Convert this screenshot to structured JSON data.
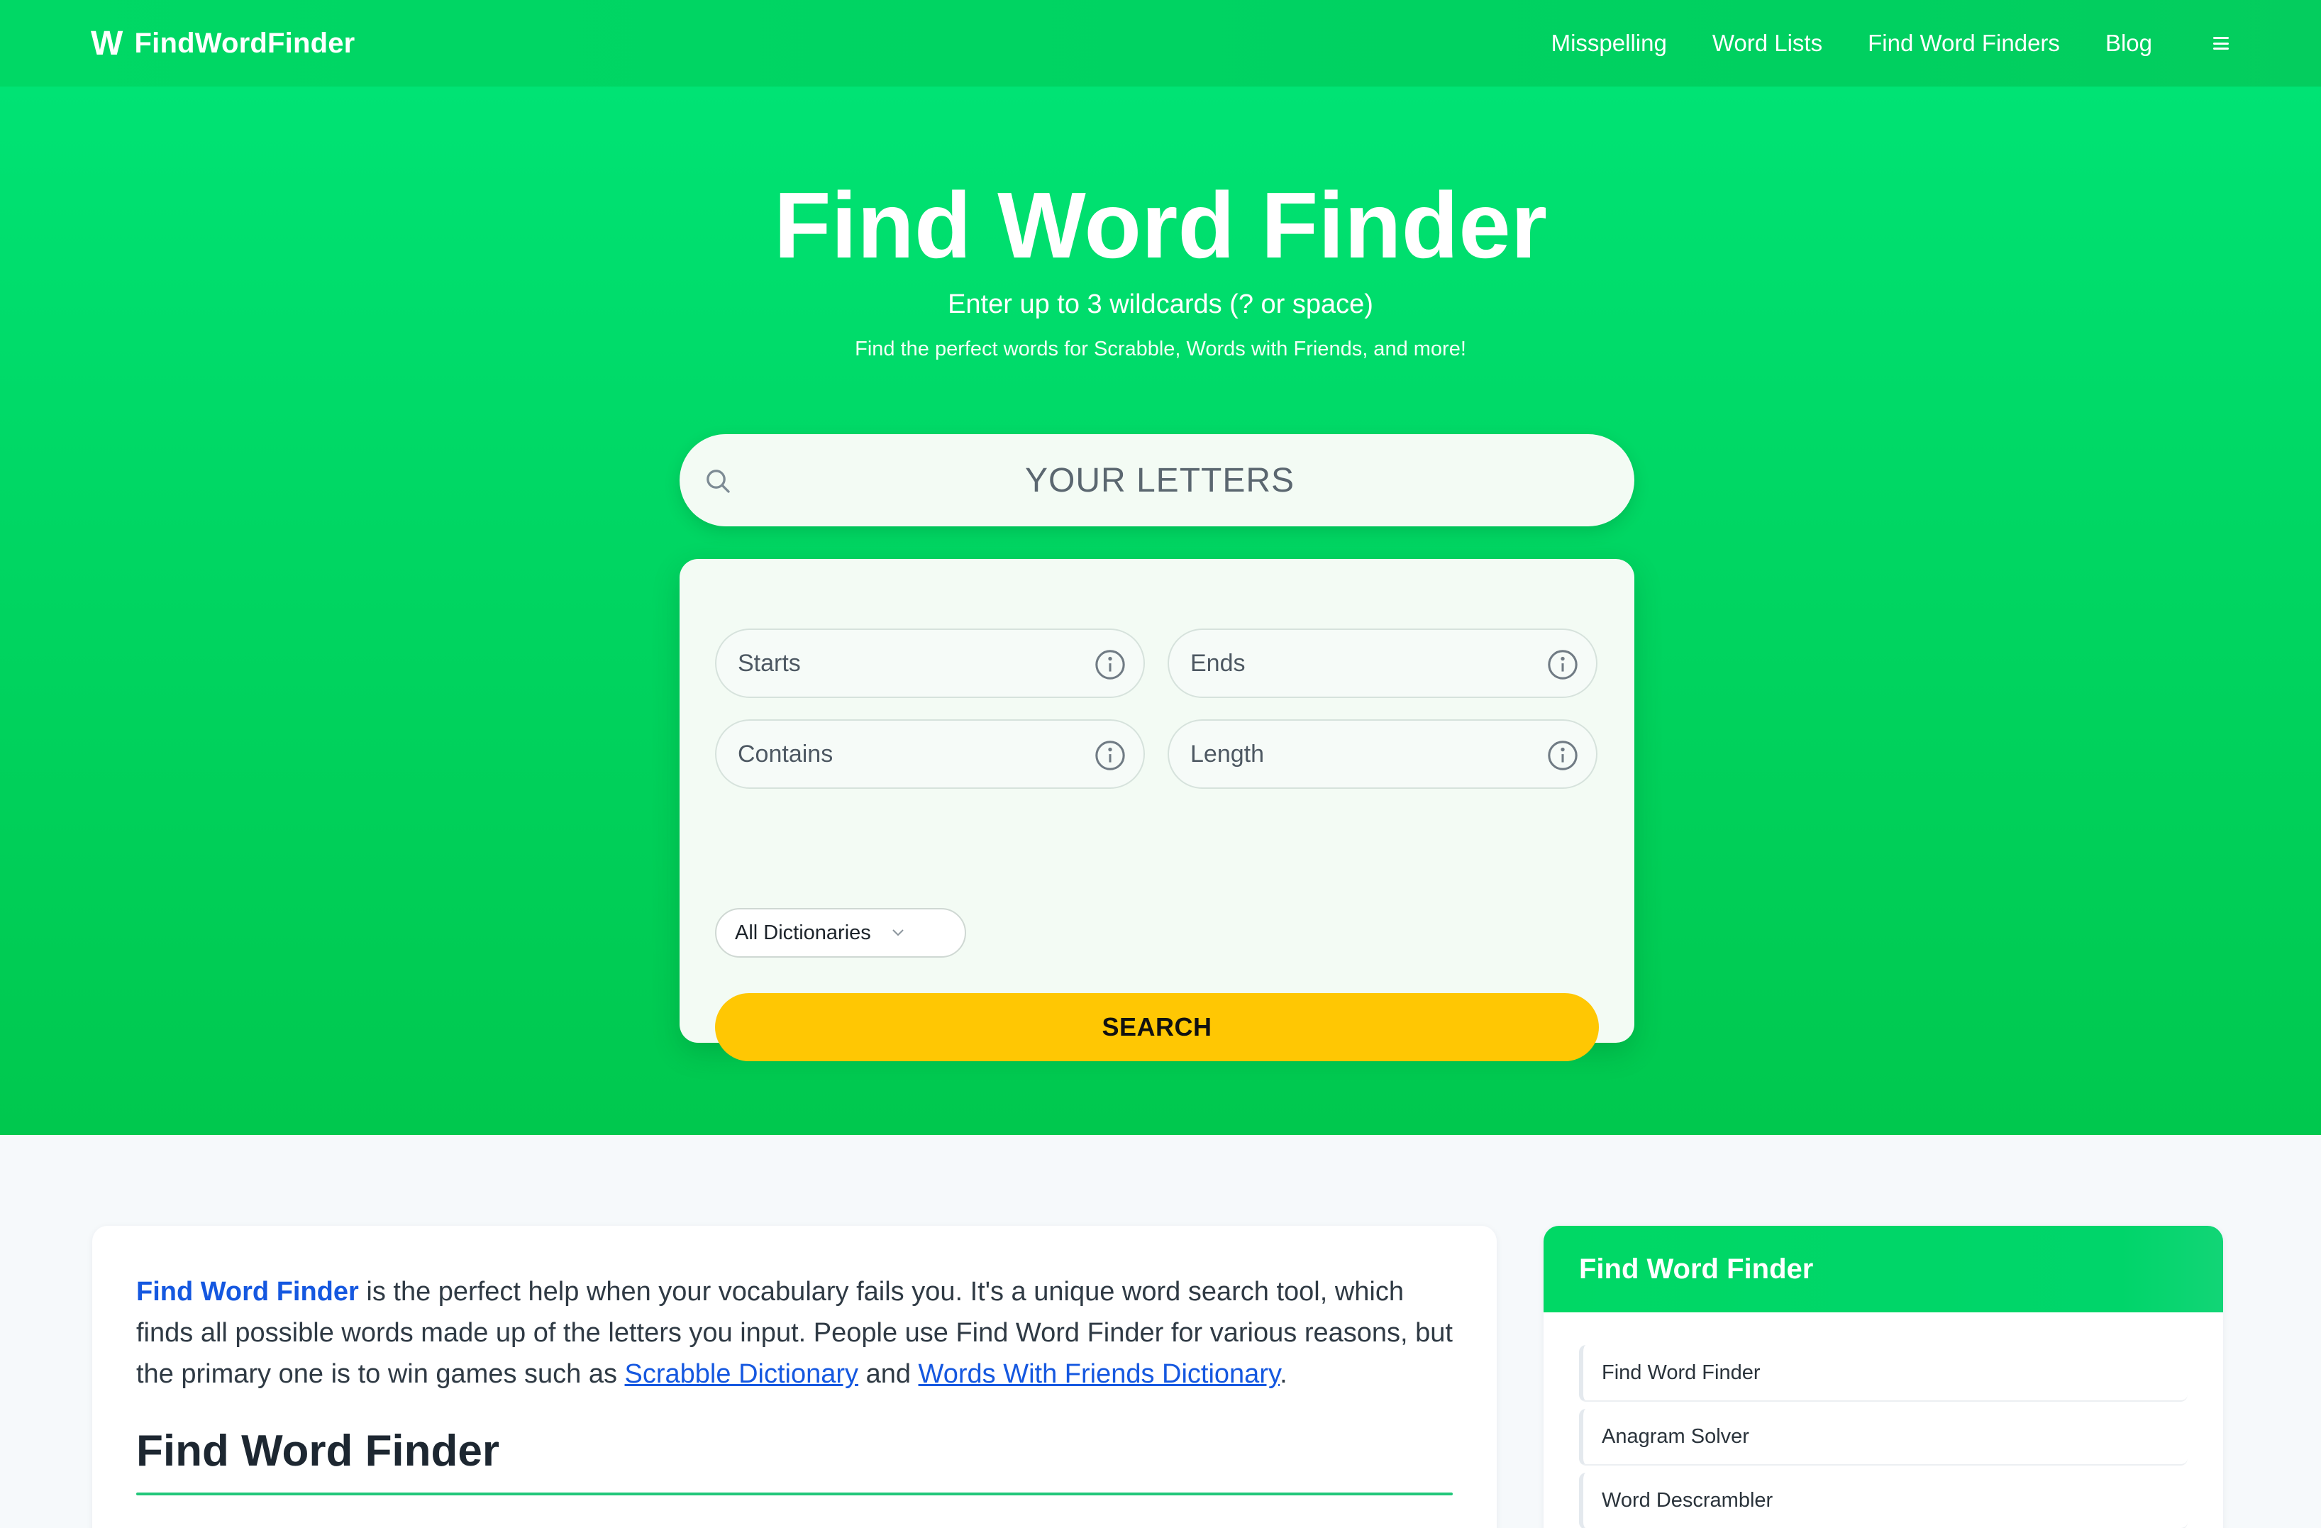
{
  "nav": {
    "brand_mark": "W",
    "brand": "FindWordFinder",
    "links": [
      "Misspelling",
      "Word Lists",
      "Find Word Finders",
      "Blog"
    ],
    "menu_icon": "hamburger-menu-icon"
  },
  "hero": {
    "title": "Find Word Finder",
    "subtitle": "Enter up to 3 wildcards (? or space)",
    "tagline": "Find the perfect words for Scrabble, Words with Friends, and more!",
    "search": {
      "placeholder": "YOUR LETTERS",
      "icon": "search-icon"
    },
    "filters": {
      "starts": "Starts",
      "ends": "Ends",
      "contains": "Contains",
      "length": "Length",
      "info_icon": "info-icon"
    },
    "dictionary": {
      "selected": "All Dictionaries"
    },
    "search_button": "SEARCH"
  },
  "article": {
    "intro_link": "Find Word Finder",
    "intro_text": " is the perfect help when your vocabulary fails you. It's a unique word search tool, which finds all possible words made up of the letters you input. People use Find Word Finder for various reasons, but the primary one is to win games such as ",
    "link_scrabble": "Scrabble Dictionary",
    "and_text": " and ",
    "link_wwf": "Words With Friends Dictionary",
    "end_text": ".",
    "heading": "Find Word Finder"
  },
  "sidebar": {
    "title": "Find Word Finder",
    "items": [
      "Find Word Finder",
      "Anagram Solver",
      "Word Descrambler"
    ]
  },
  "colors": {
    "brand_green": "#00d865",
    "button_yellow": "#ffc703",
    "link_blue": "#1558e0",
    "rule_green": "#22c77a"
  }
}
